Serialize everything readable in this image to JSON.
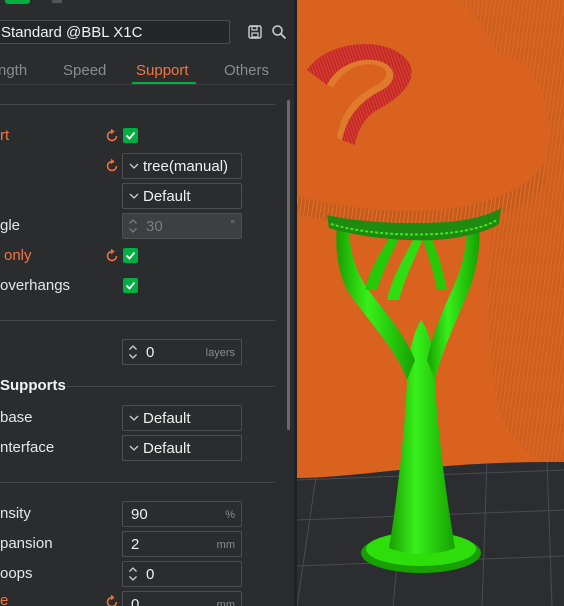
{
  "preset": {
    "name": "Standard @BBL X1C"
  },
  "tabs": [
    {
      "label": "ngth"
    },
    {
      "label": "Speed"
    },
    {
      "label": "Support"
    },
    {
      "label": "Others"
    }
  ],
  "settings": {
    "enable_support": {
      "label": "rt",
      "checked": true
    },
    "type": {
      "label": "",
      "value": "tree(manual)"
    },
    "style": {
      "value": "Default"
    },
    "threshold_angle": {
      "label": "gle",
      "value": "30",
      "unit": "°"
    },
    "on_build_plate_only": {
      "label": "only",
      "checked": true
    },
    "remove_small_overhangs": {
      "label": "overhangs",
      "checked": true
    },
    "raft_layers": {
      "value": "0",
      "unit": "layers"
    },
    "section_title": "Supports",
    "base_pattern": {
      "label": "base",
      "value": "Default"
    },
    "interface_pattern": {
      "label": "nterface",
      "value": "Default"
    },
    "density": {
      "label": "nsity",
      "value": "90",
      "unit": "%"
    },
    "expansion": {
      "label": "pansion",
      "value": "2",
      "unit": "mm"
    },
    "loops": {
      "label": "oops",
      "value": "0"
    },
    "bottom_field": {
      "label": "e",
      "value": "0",
      "unit": "mm"
    }
  },
  "colors": {
    "accent_green": "#00ae42",
    "accent_orange": "#f4753e",
    "model_orange": "#d9621f",
    "support_green": "#22dd00"
  }
}
